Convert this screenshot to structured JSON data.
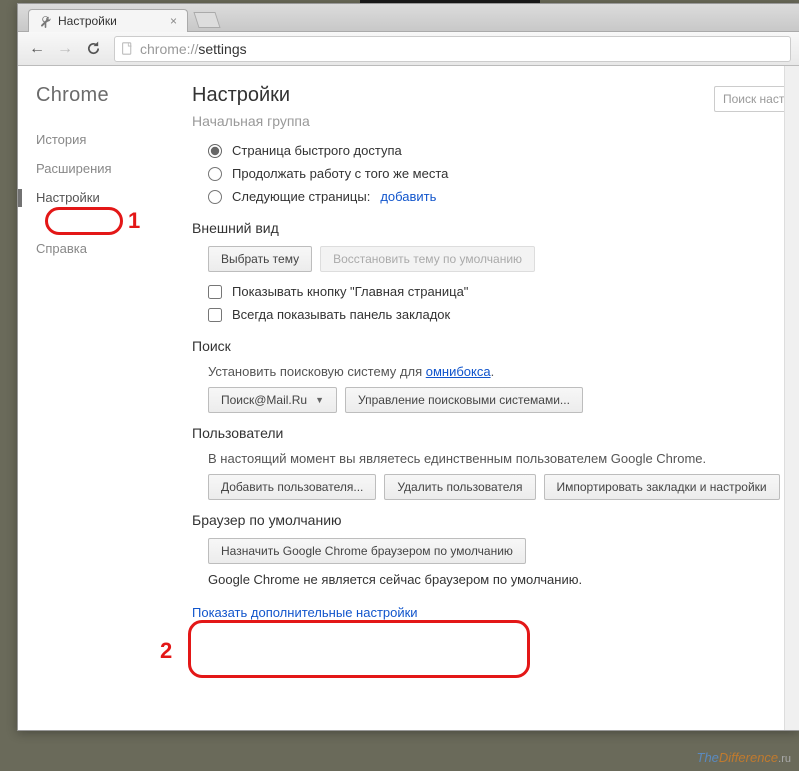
{
  "tab": {
    "title": "Настройки"
  },
  "omnibox": {
    "scheme": "chrome://",
    "path": "settings"
  },
  "sidebar": {
    "brand": "Chrome",
    "items": [
      {
        "label": "История"
      },
      {
        "label": "Расширения"
      },
      {
        "label": "Настройки"
      },
      {
        "label": "Справка"
      }
    ]
  },
  "page": {
    "title": "Настройки",
    "search_placeholder": "Поиск настр"
  },
  "startup": {
    "title": "Начальная группа",
    "opt_quick": "Страница быстрого доступа",
    "opt_continue": "Продолжать работу с того же места",
    "opt_pages": "Следующие страницы:",
    "add_link": "добавить"
  },
  "appearance": {
    "title": "Внешний вид",
    "choose_theme": "Выбрать тему",
    "restore_theme": "Восстановить тему по умолчанию",
    "show_home": "Показывать кнопку \"Главная страница\"",
    "always_bookmarks": "Всегда показывать панель закладок"
  },
  "search": {
    "title": "Поиск",
    "desc_prefix": "Установить поисковую систему для ",
    "desc_link": "омнибокса",
    "engine": "Поиск@Mail.Ru",
    "manage": "Управление поисковыми системами..."
  },
  "users": {
    "title": "Пользователи",
    "desc": "В настоящий момент вы являетесь единственным пользователем Google Chrome.",
    "add": "Добавить пользователя...",
    "delete": "Удалить пользователя",
    "import": "Импортировать закладки и настройки"
  },
  "default_browser": {
    "title": "Браузер по умолчанию",
    "button": "Назначить Google Chrome браузером по умолчанию",
    "status": "Google Chrome не является сейчас браузером по умолчанию."
  },
  "advanced_link": "Показать дополнительные настройки",
  "annotations": {
    "one": "1",
    "two": "2"
  },
  "watermark": {
    "a": "The",
    "b": "Difference",
    "c": ".ru"
  }
}
